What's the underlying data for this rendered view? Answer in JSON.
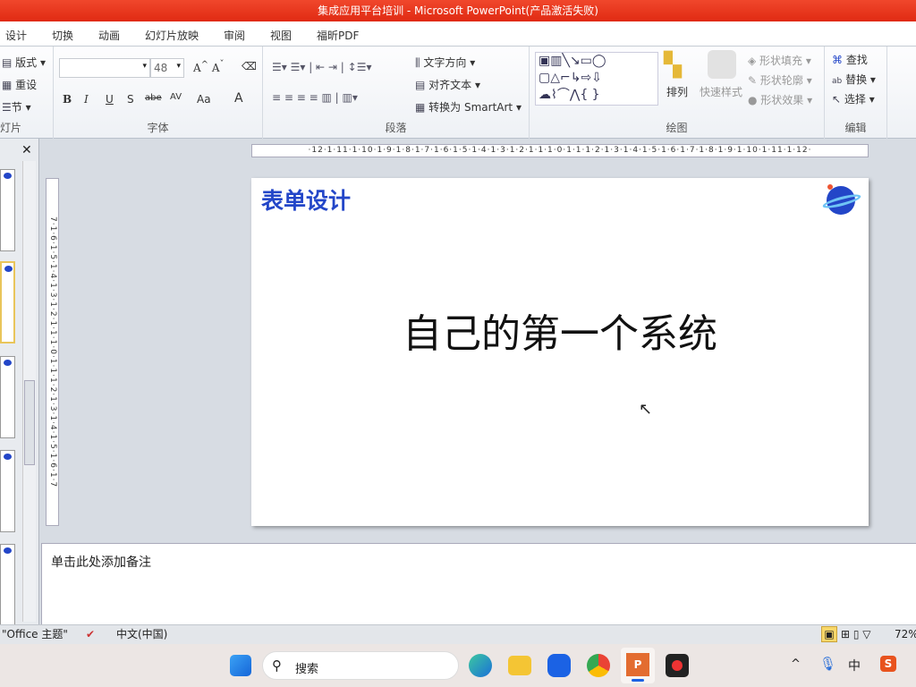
{
  "window": {
    "title": "集成应用平台培训 - Microsoft PowerPoint(产品激活失败)"
  },
  "tabs": [
    "设计",
    "切换",
    "动画",
    "幻灯片放映",
    "审阅",
    "视图",
    "福昕PDF"
  ],
  "ribbon": {
    "slides": {
      "layout": "版式",
      "reset": "重设",
      "section": "节",
      "label": "灯片"
    },
    "font": {
      "font_name": "",
      "font_size": "48",
      "label": "字体",
      "bold": "B",
      "italic": "I",
      "underline": "U",
      "shadow": "S",
      "strike": "abe",
      "spacing": "AV",
      "case": "Aa",
      "color": "A"
    },
    "paragraph": {
      "text_direction": "文字方向",
      "align_text": "对齐文本",
      "smartart": "转换为 SmartArt",
      "label": "段落"
    },
    "drawing": {
      "arrange": "排列",
      "quick_styles": "快速样式",
      "shape_fill": "形状填充",
      "shape_outline": "形状轮廓",
      "shape_effects": "形状效果",
      "label": "绘图"
    },
    "editing": {
      "find": "查找",
      "replace": "替换",
      "select": "选择",
      "label": "编辑"
    }
  },
  "ruler": {
    "horizontal": "·12·1·11·1·10·1·9·1·8·1·7·1·6·1·5·1·4·1·3·1·2·1·1·1·0·1·1·1·2·1·3·1·4·1·5·1·6·1·7·1·8·1·9·1·10·1·11·1·12·",
    "vertical": "7·1·6·1·5·1·4·1·3·1·2·1·1·1·0·1·1·1·2·1·3·1·4·1·5·1·6·1·7"
  },
  "slide": {
    "header": "表单设计",
    "title": "自己的第一个系统"
  },
  "notes": {
    "placeholder": "单击此处添加备注"
  },
  "status": {
    "theme": "\"Office 主题\"",
    "language": "中文(中国)",
    "zoom": "72%"
  },
  "taskbar": {
    "search": "搜索",
    "ime": "中"
  },
  "colors": {
    "title_bar": "#e02a12",
    "slide_header": "#2346c8"
  }
}
